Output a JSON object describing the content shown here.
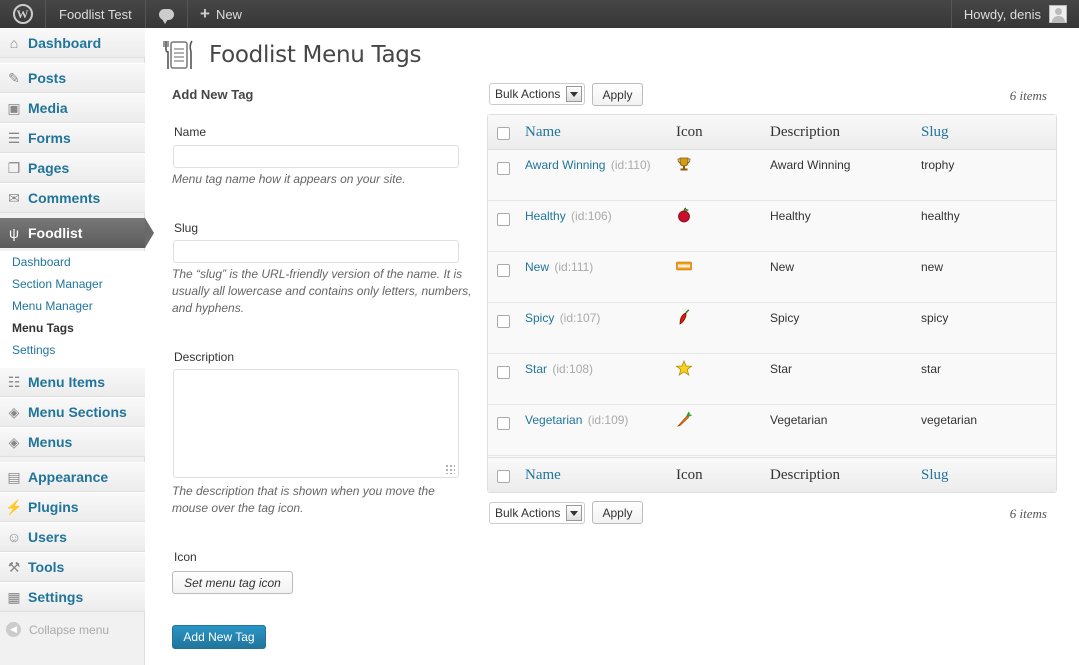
{
  "admin_bar": {
    "site_name": "Foodlist Test",
    "new_label": "New",
    "greeting": "Howdy, denis"
  },
  "sidebar": {
    "items": [
      {
        "label": "Dashboard",
        "icon": "dashboard-icon"
      },
      {
        "label": "Posts",
        "icon": "pin-icon"
      },
      {
        "label": "Media",
        "icon": "media-icon"
      },
      {
        "label": "Forms",
        "icon": "forms-icon"
      },
      {
        "label": "Pages",
        "icon": "pages-icon"
      },
      {
        "label": "Comments",
        "icon": "comments-icon"
      },
      {
        "label": "Foodlist",
        "icon": "utensils-icon"
      },
      {
        "label": "Menu Items",
        "icon": "menu-items-icon"
      },
      {
        "label": "Menu Sections",
        "icon": "diamond-icon"
      },
      {
        "label": "Menus",
        "icon": "diamond-icon"
      },
      {
        "label": "Appearance",
        "icon": "appearance-icon"
      },
      {
        "label": "Plugins",
        "icon": "plug-icon"
      },
      {
        "label": "Users",
        "icon": "users-icon"
      },
      {
        "label": "Tools",
        "icon": "tools-icon"
      },
      {
        "label": "Settings",
        "icon": "settings-icon"
      }
    ],
    "submenu": [
      "Dashboard",
      "Section Manager",
      "Menu Manager",
      "Menu Tags",
      "Settings"
    ],
    "collapse_label": "Collapse menu"
  },
  "page": {
    "title": "Foodlist Menu Tags"
  },
  "form": {
    "heading": "Add New Tag",
    "name_label": "Name",
    "name_value": "",
    "name_help": "Menu tag name how it appears on your site.",
    "slug_label": "Slug",
    "slug_value": "",
    "slug_help": "The “slug” is the URL-friendly version of the name. It is usually all lowercase and contains only letters, numbers, and hyphens.",
    "description_label": "Description",
    "description_value": "",
    "description_help": "The description that is shown when you move the mouse over the tag icon.",
    "icon_label": "Icon",
    "set_icon_button": "Set menu tag icon",
    "submit_button": "Add New Tag"
  },
  "tablenav": {
    "bulk_actions": "Bulk Actions",
    "apply": "Apply",
    "count": "6 items"
  },
  "table": {
    "columns": [
      "Name",
      "Icon",
      "Description",
      "Slug"
    ],
    "rows": [
      {
        "name": "Award Winning",
        "id": "(id:110)",
        "icon": "trophy-icon",
        "description": "Award Winning",
        "slug": "trophy"
      },
      {
        "name": "Healthy",
        "id": "(id:106)",
        "icon": "apple-icon",
        "description": "Healthy",
        "slug": "healthy"
      },
      {
        "name": "New",
        "id": "(id:111)",
        "icon": "new-badge-icon",
        "description": "New",
        "slug": "new"
      },
      {
        "name": "Spicy",
        "id": "(id:107)",
        "icon": "chili-icon",
        "description": "Spicy",
        "slug": "spicy"
      },
      {
        "name": "Star",
        "id": "(id:108)",
        "icon": "star-icon",
        "description": "Star",
        "slug": "star"
      },
      {
        "name": "Vegetarian",
        "id": "(id:109)",
        "icon": "carrot-icon",
        "description": "Vegetarian",
        "slug": "vegetarian"
      }
    ]
  },
  "colors": {
    "link": "#21759b",
    "admin_bar": "#464646",
    "current_menu": "#6a6a6a"
  }
}
